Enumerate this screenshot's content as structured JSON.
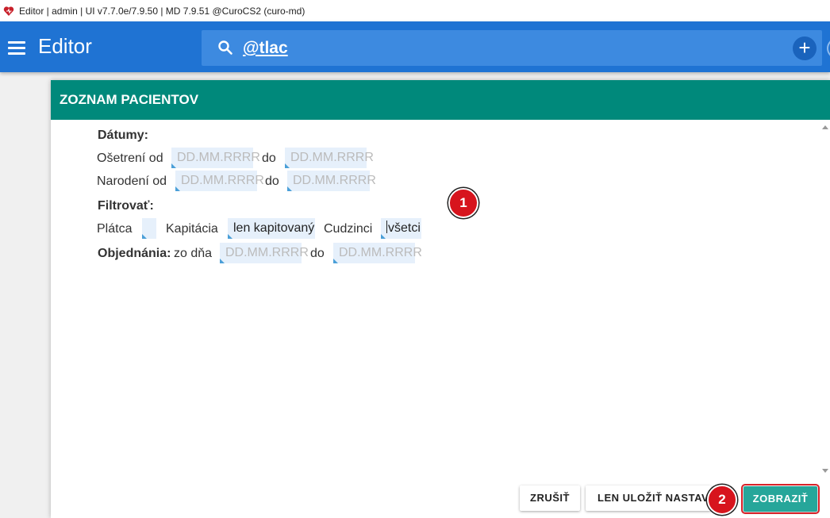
{
  "window": {
    "title": "Editor | admin | UI v7.7.0e/7.9.50 | MD 7.9.51 @CuroCS2 (curo-md)"
  },
  "appbar": {
    "title": "Editor",
    "search_value": "@tlac",
    "add_label": "+"
  },
  "dialog": {
    "title": "ZOZNAM PACIENTOV",
    "dates_heading": "Dátumy:",
    "treated_from_label": "Ošetrení od",
    "treated_to_label": "do",
    "born_from_label": "Narodení od",
    "born_to_label": "do",
    "date_placeholder": "DD.MM.RRRR",
    "filter_heading": "Filtrovať:",
    "payer_label": "Plátca",
    "payer_value": "",
    "capitation_label": "Kapitácia",
    "capitation_value": "len kapitovaný",
    "foreigners_label": "Cudzinci",
    "foreigners_value": "všetci",
    "orders_label": "Objednánia:",
    "orders_from_label": "zo dňa",
    "orders_to_label": "do"
  },
  "buttons": {
    "cancel_label": "ZRUŠIŤ",
    "save_label": "LEN ULOŽIŤ NASTAVENIE",
    "show_label": "ZOBRAZIŤ"
  },
  "markers": {
    "one": "1",
    "two": "2"
  },
  "colors": {
    "appbar": "#1f73d3",
    "header": "#00897b",
    "primary_button": "#26a69a",
    "highlight": "#d9232a"
  }
}
